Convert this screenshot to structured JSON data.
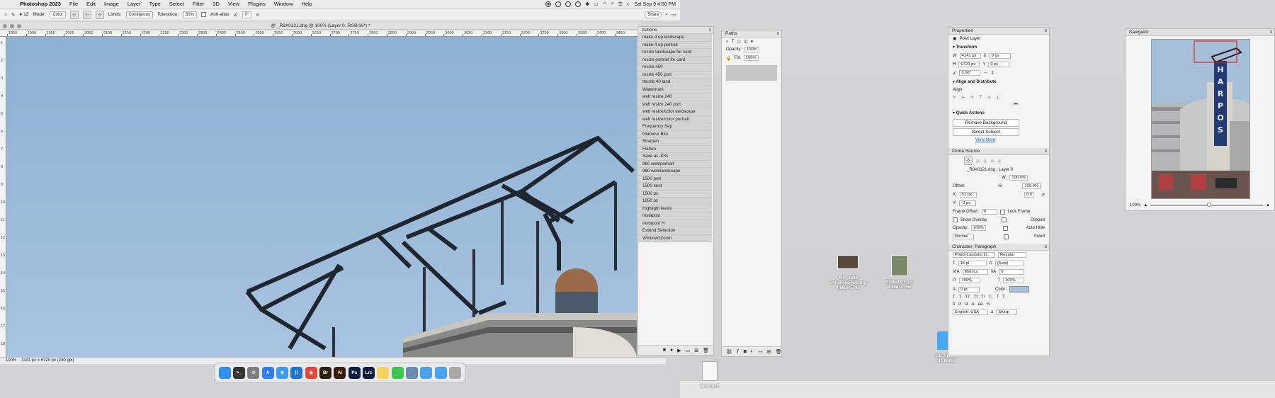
{
  "menubar": {
    "app_name": "Photoshop 2023",
    "items": [
      "File",
      "Edit",
      "Image",
      "Layer",
      "Type",
      "Select",
      "Filter",
      "3D",
      "View",
      "Plugins",
      "Window",
      "Help"
    ],
    "datetime": "Sat Sep 9  4:50 PM"
  },
  "options": {
    "mode_label": "Mode:",
    "mode_value": "Color",
    "limits_label": "Limits:",
    "limits_value": "Contiguous",
    "tolerance_label": "Tolerance:",
    "tolerance_value": "30%",
    "antialias_label": "Anti-alias",
    "angle_value": "0°",
    "brush_size": "13",
    "share_label": "Share"
  },
  "document": {
    "title": "@ _R9A0121.dng @ 100% (Layer 0, RGB/16*) *",
    "status_zoom": "100%",
    "status_info": "4141 px x 6720 px (240 ppi)"
  },
  "ruler": {
    "h_ticks": [
      "1850",
      "1900",
      "1950",
      "2000",
      "2050",
      "2100",
      "2150",
      "2200",
      "2250",
      "2300",
      "2350",
      "2400",
      "2450",
      "2500",
      "2550",
      "2600",
      "2650",
      "2700",
      "2750",
      "2800",
      "2850",
      "2900",
      "2950",
      "3000",
      "3050",
      "3100",
      "3150",
      "3200",
      "3250",
      "3300",
      "3350",
      "3400",
      "3450"
    ],
    "v_ticks": [
      "1",
      "2",
      "3",
      "4",
      "5",
      "6",
      "7",
      "8",
      "9",
      "10",
      "11",
      "12",
      "13",
      "14",
      "15",
      "16",
      "17",
      "18"
    ]
  },
  "actions": {
    "title": "Actions",
    "items": [
      "make 4 up landscape",
      "make 4 up portrait",
      "resize landscape for card",
      "resize portrait for card",
      "resize 450",
      "resize 450 port",
      "thumb 40 land",
      "Watermark",
      "web resize 240",
      "web resize 240 port",
      "web resize/color landscape",
      "web resize/color portrait",
      "Frequency Sep",
      "Glamour Blur",
      "Sharpen",
      "Flatten",
      "Save as JPG",
      "960 web/portrait",
      "960 web/landscape",
      "1500 port",
      "1500 land",
      "1500 px",
      "1650 px",
      "Highlight levels",
      "Instapost",
      "Instapost H",
      "Extend Selection",
      "Window2Zoom"
    ]
  },
  "paths": {
    "title": "Paths",
    "opacity_label": "Opacity:",
    "opacity_value": "100%",
    "fill_label": "Fill:",
    "fill_value": "100%"
  },
  "properties": {
    "title": "Properties",
    "layer_type": "Pixel Layer",
    "transform": {
      "title": "Transform",
      "w_label": "W",
      "w": "4141 px",
      "h_label": "H",
      "h": "6720 px",
      "x_label": "X",
      "x": "0 px",
      "y_label": "Y",
      "y": "0 px",
      "angle": "0.00°"
    },
    "align_title": "Align and Distribute",
    "align_label": "Align:",
    "more": "•••",
    "quick_actions_title": "Quick Actions",
    "remove_bg": "Remove Background",
    "select_subject": "Select Subject",
    "view_more": "View More"
  },
  "clone_source": {
    "title": "Clone Source",
    "source_name": "_R9A0121.dng : Layer 0",
    "offset_label": "Offset:",
    "x_label": "X:",
    "x": "52 px",
    "y_label": "Y:",
    "y": "-3 px",
    "w_label": "W:",
    "w": "100.0%",
    "h_label": "H:",
    "h": "100.0%",
    "angle": "0.0",
    "frame_offset_label": "Frame Offset:",
    "frame_offset": "0",
    "lock_frame": "Lock Frame",
    "show_overlay": "Show Overlay",
    "opacity_label": "Opacity:",
    "opacity": "100%",
    "clipped": "Clipped",
    "auto_hide": "Auto Hide",
    "invert": "Invert",
    "blend": "Normal"
  },
  "character": {
    "tab_character": "Character",
    "tab_paragraph": "Paragraph",
    "font": "Poppl-Laudatio Li...",
    "style": "Regular",
    "size": "15 pt",
    "leading": "(Auto)",
    "kerning": "Metrics",
    "tracking": "0",
    "vscale": "100%",
    "hscale": "100%",
    "baseline": "0 pt",
    "color_label": "Color:",
    "color_hex": "#a8c0dc",
    "language": "English: USA",
    "aa_label": "a",
    "antialias": "Sharp"
  },
  "navigator": {
    "title": "Navigator",
    "zoom": "100%",
    "sign_text": "HARPOS"
  },
  "desktop": {
    "files": [
      {
        "name": "_MG_2696-Enhanced-NR.dng",
        "size": "4,668×5,793"
      },
      {
        "name": "Edited2-1.jpg",
        "size": "4,688×4,656"
      },
      {
        "name": "CL Photos",
        "size": "41 items"
      },
      {
        "name": "backup 2",
        "size": ""
      }
    ]
  },
  "dock": {
    "apps": [
      {
        "icon": "finder-icon",
        "label": "",
        "color": "#2f8ef0"
      },
      {
        "icon": "terminal-icon",
        "label": ">_",
        "color": "#333333"
      },
      {
        "icon": "system-settings-icon",
        "label": "⚙",
        "color": "#7d7d7d"
      },
      {
        "icon": "app-store-icon",
        "label": "A",
        "color": "#2f7ef5"
      },
      {
        "icon": "safari-icon",
        "label": "⊕",
        "color": "#3a9bf0"
      },
      {
        "icon": "vscode-icon",
        "label": "⟨⟩",
        "color": "#1d76c9"
      },
      {
        "icon": "chrome-icon",
        "label": "◉",
        "color": "#e04a3a"
      },
      {
        "icon": "bridge-icon",
        "label": "Br",
        "color": "#2b1f10"
      },
      {
        "icon": "illustrator-icon",
        "label": "Ai",
        "color": "#3a1e06"
      },
      {
        "icon": "photoshop-icon",
        "label": "Ps",
        "color": "#0a1f3b"
      },
      {
        "icon": "lightroom-classic-icon",
        "label": "Lrc",
        "color": "#0a1f3b"
      },
      {
        "icon": "notes-icon",
        "label": "",
        "color": "#f5d25c"
      },
      {
        "icon": "messages-icon",
        "label": "",
        "color": "#3bc751"
      },
      {
        "icon": "preview-icon",
        "label": "",
        "color": "#6a8bb0"
      },
      {
        "icon": "folder-icon",
        "label": "",
        "color": "#4aa3e8"
      },
      {
        "icon": "downloads-folder-icon",
        "label": "",
        "color": "#4aa3e8"
      },
      {
        "icon": "trash-icon",
        "label": "",
        "color": "#a9a9a9"
      }
    ]
  }
}
